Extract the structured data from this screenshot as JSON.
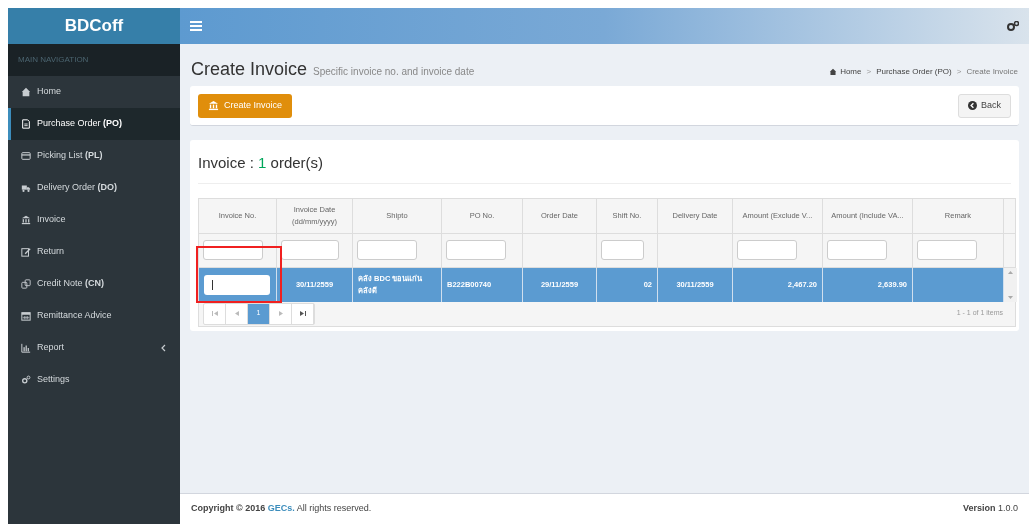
{
  "sidebar": {
    "logo": "BDCoff",
    "section_label": "MAIN NAVIGATION",
    "items": [
      {
        "label": "Home",
        "selected": false,
        "expandable": false
      },
      {
        "label": "Purchase Order **(PO)**",
        "selected": true,
        "expandable": false
      },
      {
        "label": "Picking List **(PL)**",
        "selected": false,
        "expandable": false
      },
      {
        "label": "Delivery Order **(DO)**",
        "selected": false,
        "expandable": false
      },
      {
        "label": "Invoice",
        "selected": false,
        "expandable": false
      },
      {
        "label": "Return",
        "selected": false,
        "expandable": false
      },
      {
        "label": "Credit Note **(CN)**",
        "selected": false,
        "expandable": false
      },
      {
        "label": "Remittance Advice",
        "selected": false,
        "expandable": false
      },
      {
        "label": "Report",
        "selected": false,
        "expandable": true
      },
      {
        "label": "Settings",
        "selected": false,
        "expandable": false
      }
    ]
  },
  "page": {
    "title": "Create Invoice",
    "subtitle": "Specific invoice no. and invoice date",
    "breadcrumb": [
      "Home",
      "Purchase Order (PO)",
      "Create Invoice"
    ],
    "breadcrumb_separators": [
      ">",
      ">"
    ]
  },
  "toolbar": {
    "create_button": "Create Invoice",
    "back_button": "Back"
  },
  "panel": {
    "heading_prefix": "Invoice : ",
    "count": "1",
    "heading_suffix": " order(s)"
  },
  "table": {
    "columns": [
      {
        "label": "Invoice No.",
        "filter": true
      },
      {
        "label": "Invoice Date (dd/mm/yyyy)",
        "filter": true
      },
      {
        "label": "Shipto",
        "filter": true
      },
      {
        "label": "PO No.",
        "filter": true
      },
      {
        "label": "Order Date",
        "filter": false
      },
      {
        "label": "Shift No.",
        "filter": true
      },
      {
        "label": "Delivery Date",
        "filter": false
      },
      {
        "label": "Amount (Exclude V...",
        "filter": true
      },
      {
        "label": "Amount (Include VA...",
        "filter": true
      },
      {
        "label": "Remark",
        "filter": true
      }
    ],
    "rows": [
      {
        "selected": true,
        "editing_invoice_no": true,
        "cells": [
          "",
          "30/11/2559",
          "คลัง BDC ขอนแก่น คลังดี",
          "B222B00740",
          "29/11/2559",
          "02",
          "30/11/2559",
          "2,467.20",
          "2,639.90",
          ""
        ]
      }
    ],
    "pager": {
      "pages": [
        {
          "label": "1",
          "selected": true
        }
      ],
      "summary": "1 - 1 of 1 items"
    }
  },
  "footer": {
    "copyright": "**Copyright © 2016** ",
    "link": "GECs.",
    "rest": " All rights reserved.",
    "version_label": "Version",
    "version": "1.0.0"
  }
}
